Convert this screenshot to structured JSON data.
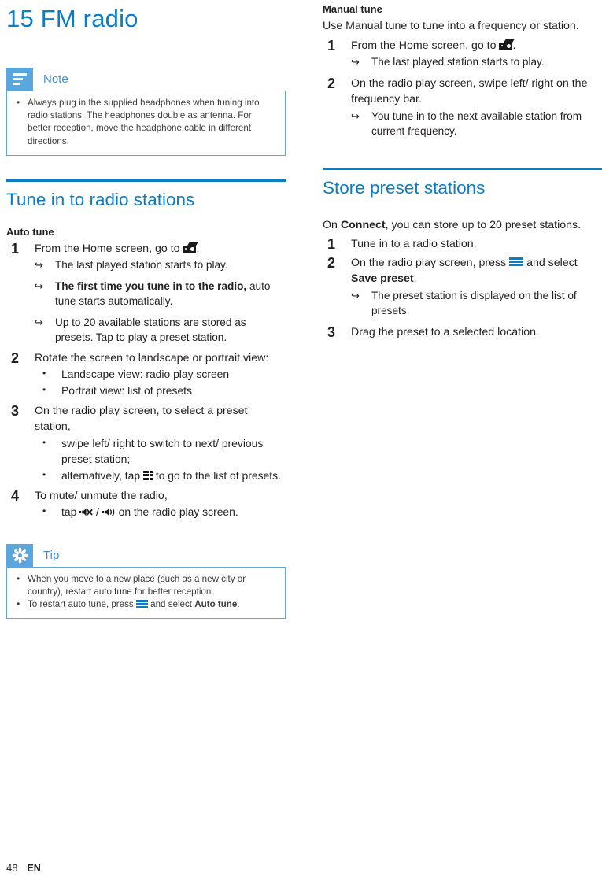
{
  "document": {
    "chapter_number_title": "15 FM radio",
    "footer": {
      "page_number": "48",
      "language": "EN"
    }
  },
  "note_callout": {
    "icon": "note-lines-icon",
    "title": "Note",
    "accent_color": "#5ba7dd",
    "items": [
      "Always plug in the supplied headphones when tuning into radio stations. The headphones double as antenna. For better reception, move the headphone cable in different directions."
    ]
  },
  "tune_section": {
    "heading": "Tune in to radio stations",
    "heading_color": "#0b7dc4",
    "auto_tune": {
      "sub_heading": "Auto tune",
      "step1": {
        "number": "1",
        "text_before_icon": "From the Home screen, go to",
        "icon": "radio-icon",
        "text_after_icon": ".",
        "results": [
          {
            "text": "The last played station starts to play.",
            "bold_lead": ""
          },
          {
            "bold_lead": "The first time you tune in to the radio,",
            "text": " auto tune starts automatically."
          },
          {
            "text": "Up to 20 available stations are stored as presets. Tap to play a preset station.",
            "bold_lead": ""
          }
        ]
      },
      "step2": {
        "number": "2",
        "text": "Rotate the screen to landscape or portrait view:",
        "bullets": [
          "Landscape view: radio play screen",
          "Portrait view: list of presets"
        ]
      },
      "step3": {
        "number": "3",
        "text": "On the radio play screen, to select a preset station,",
        "bullet1": "swipe left/ right to switch to next/ previous preset station;",
        "bullet2_before": "alternatively, tap",
        "bullet2_icon": "grid-icon",
        "bullet2_after": "to go to the list of presets."
      },
      "step4": {
        "number": "4",
        "text": "To mute/ unmute the radio,",
        "bullet_before": "tap",
        "bullet_icon_mute": "mute-icon",
        "bullet_separator": "/",
        "bullet_icon_speaker": "speaker-icon",
        "bullet_after": "on the radio play screen."
      }
    }
  },
  "tip_callout": {
    "icon": "tip-asterisk-icon",
    "title": "Tip",
    "accent_color": "#5ba7dd",
    "item1": "When you move to a new place (such as a new city or country), restart auto tune for better reception.",
    "item2_before": "To restart auto tune, press",
    "item2_icon": "menu-icon",
    "item2_middle": "and select",
    "item2_bold": "Auto tune",
    "item2_after": "."
  },
  "manual_tune": {
    "sub_heading": "Manual tune",
    "intro": "Use Manual tune to tune into a frequency or station.",
    "step1": {
      "number": "1",
      "text_before_icon": "From the Home screen, go to",
      "icon": "radio-icon",
      "text_after_icon": ".",
      "result": "The last played station starts to play."
    },
    "step2": {
      "number": "2",
      "text": "On the radio play screen, swipe left/ right on the frequency bar.",
      "result": "You tune in to the next available station from current frequency."
    }
  },
  "store_section": {
    "heading": "Store preset stations",
    "heading_color": "#0b7dc4",
    "intro_before_bold": "On ",
    "intro_bold": "Connect",
    "intro_after_bold": ", you can store up to 20 preset stations.",
    "step1": {
      "number": "1",
      "text": "Tune in to a radio station."
    },
    "step2": {
      "number": "2",
      "text_before_icon": "On the radio play screen, press",
      "icon": "menu-icon",
      "text_after_icon": "and select",
      "bold": "Save preset",
      "text_end": ".",
      "result": "The preset station is displayed on the list of presets."
    },
    "step3": {
      "number": "3",
      "text": "Drag the preset to a selected location."
    }
  }
}
